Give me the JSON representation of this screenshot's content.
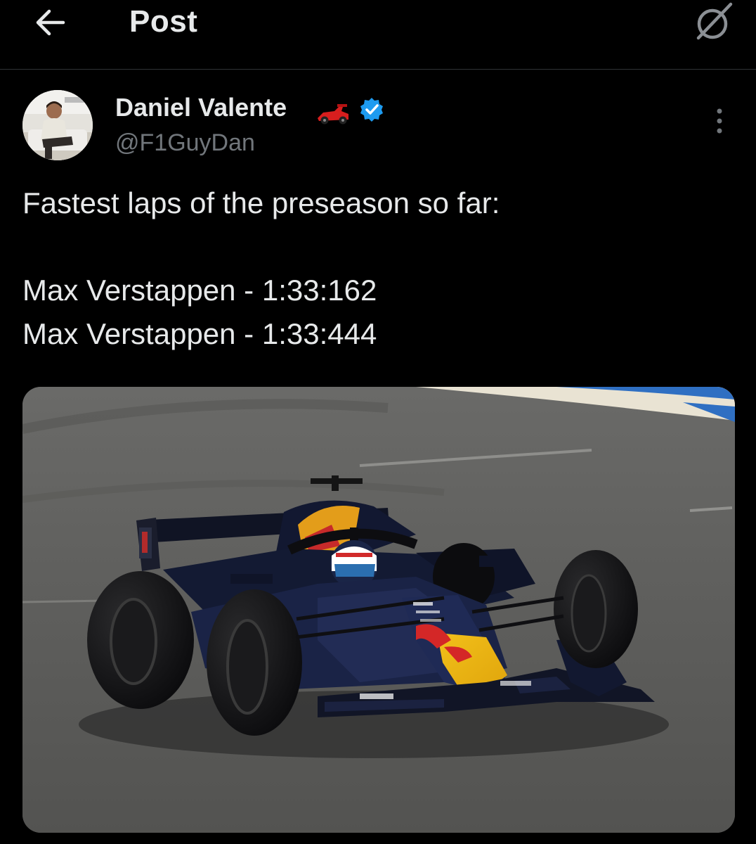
{
  "header": {
    "title": "Post",
    "back_icon": "arrow-left-icon",
    "grok_icon": "grok-icon"
  },
  "author": {
    "display_name": "Daniel Valente",
    "name_emoji": "racing-car-emoji",
    "verified": true,
    "verified_color": "#1d9bf0",
    "handle": "@F1GuyDan"
  },
  "post": {
    "lines": [
      "Fastest laps of the preseason so far:",
      "",
      "Max Verstappen - 1:33:162",
      "Max Verstappen - 1:33:444"
    ]
  },
  "colors": {
    "background": "#000000",
    "text": "#e7e9ea",
    "secondary_text": "#71767b",
    "divider": "#2f3336"
  }
}
